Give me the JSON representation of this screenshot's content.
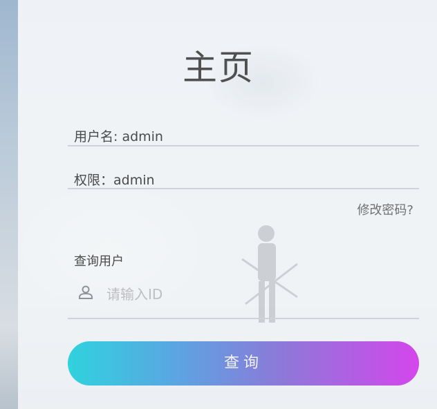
{
  "page": {
    "title": "主页"
  },
  "user_info": {
    "username_line": "用户名: admin",
    "permission_line": "权限：admin"
  },
  "links": {
    "change_password": "修改密码?"
  },
  "query": {
    "label": "查询用户",
    "input_placeholder": "请输入ID",
    "input_value": "",
    "button_label": "查询"
  },
  "icons": {
    "user": "user-icon"
  },
  "colors": {
    "button_gradient_start": "#2fd3de",
    "button_gradient_end": "#d446ec"
  }
}
